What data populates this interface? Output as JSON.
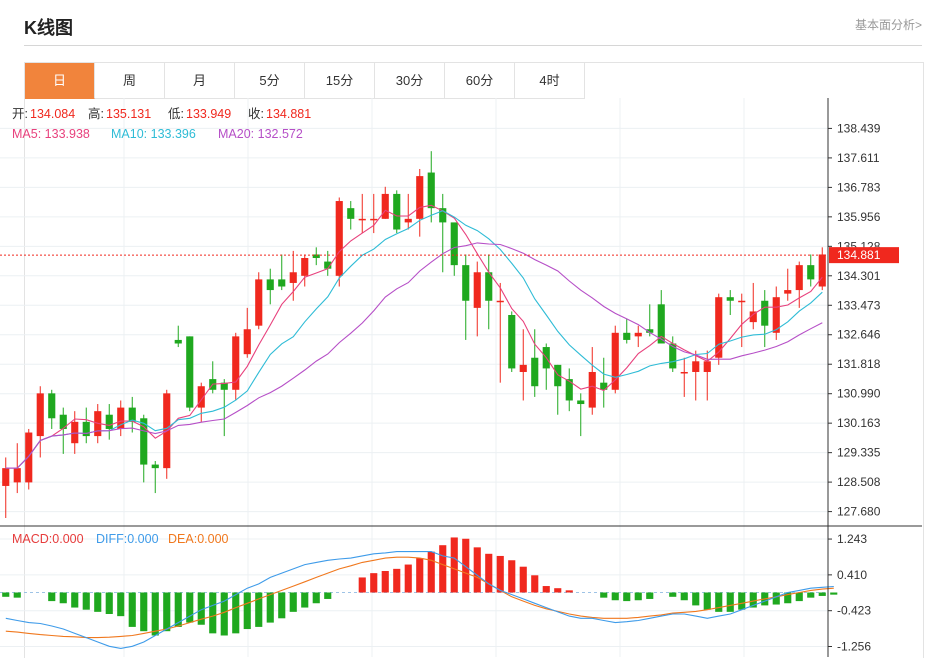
{
  "header": {
    "title": "K线图",
    "more_link": "基本面分析>"
  },
  "tabs": [
    "日",
    "周",
    "月",
    "5分",
    "15分",
    "30分",
    "60分",
    "4时"
  ],
  "active_tab": 0,
  "ohlc": {
    "open_label": "开:",
    "open": "134.084",
    "high_label": "高:",
    "high": "135.131",
    "low_label": "低:",
    "low": "133.949",
    "close_label": "收:",
    "close": "134.881"
  },
  "ma": [
    {
      "label": "MA5:",
      "value": "133.938",
      "color": "#e8417d"
    },
    {
      "label": "MA10:",
      "value": "133.396",
      "color": "#2fbcd6"
    },
    {
      "label": "MA20:",
      "value": "132.572",
      "color": "#b64fc7"
    }
  ],
  "macd_legend": [
    {
      "label": "MACD:",
      "value": "0.000",
      "color": "#e63c3c"
    },
    {
      "label": "DIFF:",
      "value": "0.000",
      "color": "#3e9be9"
    },
    {
      "label": "DEA:",
      "value": "0.000",
      "color": "#f0781e"
    }
  ],
  "colors": {
    "up": "#f0281e",
    "down": "#1fa81f",
    "grid": "#ecf0f3",
    "price_line": "#f0281e"
  },
  "chart_data": [
    {
      "type": "candlestick",
      "y_ticks": [
        "138.439",
        "137.611",
        "136.783",
        "135.956",
        "135.128",
        "134.301",
        "133.473",
        "132.646",
        "131.818",
        "130.990",
        "130.163",
        "129.335",
        "128.508",
        "127.680"
      ],
      "ylim": [
        127.5,
        138.9
      ],
      "last_price": "134.881",
      "candles": [
        [
          128.4,
          128.9,
          127.5,
          129.2
        ],
        [
          128.5,
          128.9,
          128.2,
          129.6
        ],
        [
          128.5,
          129.9,
          128.3,
          130.0
        ],
        [
          129.8,
          131.0,
          129.2,
          131.2
        ],
        [
          131.0,
          130.3,
          130.0,
          131.1
        ],
        [
          130.4,
          130.0,
          129.3,
          130.6
        ],
        [
          129.6,
          130.2,
          129.3,
          130.5
        ],
        [
          130.2,
          129.8,
          129.6,
          130.6
        ],
        [
          129.8,
          130.5,
          129.6,
          130.7
        ],
        [
          130.4,
          130.0,
          129.7,
          130.7
        ],
        [
          130.0,
          130.6,
          129.8,
          130.8
        ],
        [
          130.6,
          130.2,
          129.9,
          130.9
        ],
        [
          130.3,
          129.0,
          128.5,
          130.4
        ],
        [
          129.0,
          128.9,
          128.2,
          129.1
        ],
        [
          128.9,
          131.0,
          128.6,
          131.1
        ],
        [
          132.5,
          132.4,
          132.3,
          132.9
        ],
        [
          132.6,
          130.6,
          130.5,
          132.6
        ],
        [
          130.6,
          131.2,
          130.2,
          131.3
        ],
        [
          131.4,
          131.1,
          131.0,
          131.9
        ],
        [
          131.3,
          131.1,
          129.8,
          131.4
        ],
        [
          131.1,
          132.6,
          130.8,
          132.7
        ],
        [
          132.1,
          132.8,
          132.0,
          133.4
        ],
        [
          132.9,
          134.2,
          132.8,
          134.4
        ],
        [
          134.2,
          133.9,
          133.5,
          134.5
        ],
        [
          134.2,
          134.0,
          133.9,
          134.9
        ],
        [
          134.1,
          134.4,
          133.6,
          135.0
        ],
        [
          134.3,
          134.8,
          134.0,
          134.9
        ],
        [
          134.9,
          134.8,
          134.6,
          135.1
        ],
        [
          134.7,
          134.5,
          134.3,
          135.0
        ],
        [
          134.3,
          136.4,
          134.0,
          136.5
        ],
        [
          136.2,
          135.9,
          135.6,
          136.4
        ],
        [
          135.9,
          135.9,
          135.5,
          136.6
        ],
        [
          135.9,
          135.9,
          135.5,
          136.6
        ],
        [
          135.9,
          136.6,
          135.9,
          136.8
        ],
        [
          136.6,
          135.6,
          135.5,
          136.7
        ],
        [
          135.8,
          135.9,
          135.6,
          136.6
        ],
        [
          135.9,
          137.1,
          135.4,
          137.3
        ],
        [
          137.2,
          136.2,
          135.8,
          137.8
        ],
        [
          136.2,
          135.8,
          134.4,
          136.6
        ],
        [
          135.8,
          134.6,
          134.3,
          135.1
        ],
        [
          134.6,
          133.6,
          132.5,
          134.9
        ],
        [
          133.4,
          134.4,
          132.6,
          134.7
        ],
        [
          134.4,
          133.6,
          132.8,
          134.9
        ],
        [
          133.6,
          133.6,
          131.3,
          134.1
        ],
        [
          133.2,
          131.7,
          131.6,
          133.3
        ],
        [
          131.6,
          131.8,
          130.8,
          132.8
        ],
        [
          132.0,
          131.2,
          130.9,
          132.8
        ],
        [
          132.3,
          131.7,
          131.1,
          132.4
        ],
        [
          131.8,
          131.2,
          130.4,
          131.8
        ],
        [
          131.4,
          130.8,
          130.5,
          131.7
        ],
        [
          130.8,
          130.7,
          129.8,
          131.0
        ],
        [
          130.6,
          131.6,
          130.4,
          132.3
        ],
        [
          131.3,
          131.1,
          130.6,
          132.0
        ],
        [
          131.1,
          132.7,
          131.0,
          132.9
        ],
        [
          132.7,
          132.5,
          132.4,
          133.1
        ],
        [
          132.6,
          132.7,
          132.3,
          132.9
        ],
        [
          132.8,
          132.7,
          132.6,
          133.5
        ],
        [
          133.5,
          132.4,
          132.4,
          133.9
        ],
        [
          132.4,
          131.7,
          131.6,
          132.6
        ],
        [
          131.6,
          131.6,
          130.9,
          132.0
        ],
        [
          131.6,
          131.9,
          130.8,
          132.2
        ],
        [
          131.6,
          131.9,
          130.8,
          132.2
        ],
        [
          132.0,
          133.7,
          131.8,
          133.8
        ],
        [
          133.7,
          133.6,
          133.2,
          133.9
        ],
        [
          133.6,
          133.6,
          132.3,
          133.8
        ],
        [
          133.0,
          133.3,
          132.8,
          134.1
        ],
        [
          133.6,
          132.9,
          132.3,
          133.9
        ],
        [
          132.7,
          133.7,
          132.5,
          134.0
        ],
        [
          133.8,
          133.9,
          133.6,
          134.5
        ],
        [
          133.9,
          134.6,
          133.4,
          134.7
        ],
        [
          134.6,
          134.2,
          134.0,
          134.9
        ],
        [
          134.0,
          134.9,
          133.9,
          135.1
        ]
      ]
    },
    {
      "type": "macd",
      "y_ticks": [
        "1.243",
        "0.410",
        "-0.423",
        "-1.256"
      ],
      "ylim": [
        -1.5,
        1.5
      ],
      "histogram": [
        -0.1,
        -0.12,
        0,
        0,
        -0.2,
        -0.25,
        -0.35,
        -0.4,
        -0.45,
        -0.5,
        -0.55,
        -0.8,
        -0.9,
        -1.0,
        -0.9,
        -0.8,
        -0.7,
        -0.75,
        -0.95,
        -1.0,
        -0.95,
        -0.85,
        -0.8,
        -0.7,
        -0.6,
        -0.45,
        -0.35,
        -0.25,
        -0.15,
        0,
        0,
        0.35,
        0.45,
        0.5,
        0.55,
        0.65,
        0.8,
        0.95,
        1.1,
        1.28,
        1.25,
        1.05,
        0.9,
        0.85,
        0.75,
        0.6,
        0.4,
        0.15,
        0.1,
        0.05,
        0,
        0,
        -0.12,
        -0.18,
        -0.2,
        -0.18,
        -0.15,
        0,
        -0.1,
        -0.18,
        -0.3,
        -0.4,
        -0.45,
        -0.45,
        -0.4,
        -0.35,
        -0.3,
        -0.28,
        -0.25,
        -0.2,
        -0.12,
        -0.08,
        -0.05
      ],
      "diff": [
        -0.6,
        -0.65,
        -0.7,
        -0.72,
        -0.78,
        -0.85,
        -0.95,
        -1.05,
        -1.15,
        -1.25,
        -1.3,
        -1.25,
        -1.15,
        -1.0,
        -0.85,
        -0.7,
        -0.55,
        -0.4,
        -0.3,
        -0.2,
        -0.05,
        0.1,
        0.2,
        0.35,
        0.45,
        0.55,
        0.65,
        0.7,
        0.75,
        0.78,
        0.8,
        0.85,
        0.9,
        0.92,
        0.95,
        0.95,
        0.95,
        0.95,
        0.85,
        0.8,
        0.6,
        0.4,
        0.2,
        0.05,
        -0.05,
        -0.15,
        -0.25,
        -0.35,
        -0.45,
        -0.55,
        -0.6,
        -0.6,
        -0.65,
        -0.7,
        -0.68,
        -0.65,
        -0.6,
        -0.55,
        -0.5,
        -0.5,
        -0.55,
        -0.6,
        -0.55,
        -0.5,
        -0.4,
        -0.3,
        -0.2,
        -0.1,
        0.0,
        0.05,
        0.1,
        0.12,
        0.14
      ],
      "dea": [
        -0.9,
        -0.92,
        -0.95,
        -0.98,
        -1.0,
        -1.02,
        -1.03,
        -1.05,
        -1.05,
        -1.04,
        -1.02,
        -1.0,
        -0.95,
        -0.9,
        -0.85,
        -0.78,
        -0.7,
        -0.62,
        -0.55,
        -0.46,
        -0.35,
        -0.25,
        -0.15,
        -0.05,
        0.05,
        0.15,
        0.25,
        0.35,
        0.45,
        0.55,
        0.62,
        0.7,
        0.75,
        0.8,
        0.82,
        0.82,
        0.8,
        0.75,
        0.65,
        0.55,
        0.45,
        0.35,
        0.2,
        0.05,
        -0.1,
        -0.2,
        -0.3,
        -0.38,
        -0.44,
        -0.5,
        -0.55,
        -0.58,
        -0.6,
        -0.6,
        -0.6,
        -0.58,
        -0.55,
        -0.52,
        -0.48,
        -0.46,
        -0.44,
        -0.4,
        -0.35,
        -0.3,
        -0.25,
        -0.2,
        -0.15,
        -0.1,
        -0.05,
        0.0,
        0.05,
        0.08,
        0.1
      ]
    }
  ]
}
